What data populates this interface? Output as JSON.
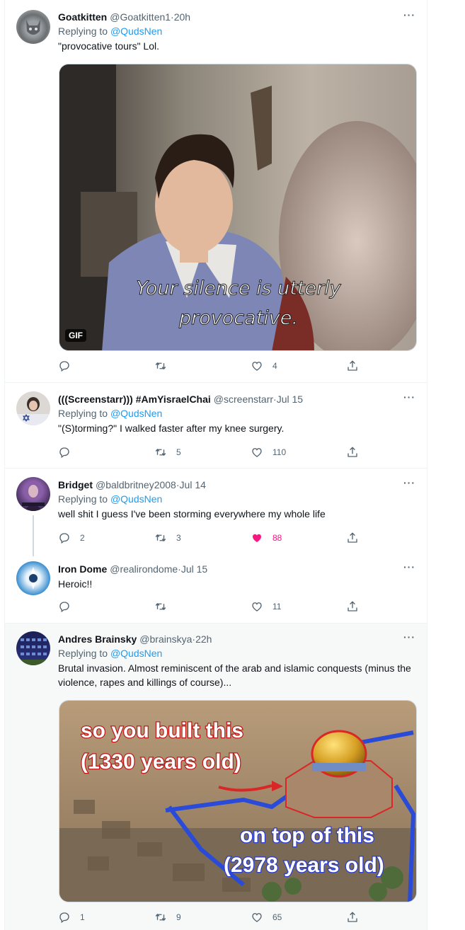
{
  "tweets": [
    {
      "name": "Goatkitten",
      "handle": "@Goatkitten1",
      "time": "20h",
      "replying_prefix": "Replying to ",
      "replying_to": "@QudsNen",
      "text": "\"provocative tours\" Lol.",
      "media": {
        "caption_line1": "Your silence is utterly",
        "caption_line2": "provocative.",
        "badge": "GIF"
      },
      "replies": "",
      "retweets": "",
      "likes": "4"
    },
    {
      "name": "(((Screenstarr))) #AmYisraelChai",
      "handle": "@screenstarr",
      "time": "Jul 15",
      "replying_prefix": "Replying to ",
      "replying_to": "@QudsNen",
      "text": "\"(S)torming?\" I walked faster after my knee surgery.",
      "replies": "",
      "retweets": "5",
      "likes": "110"
    },
    {
      "name": "Bridget",
      "handle": "@baldbritney2008",
      "time": "Jul 14",
      "replying_prefix": "Replying to ",
      "replying_to": "@QudsNen",
      "text": "well shit I guess I've been storming everywhere my whole life",
      "replies": "2",
      "retweets": "3",
      "likes": "88"
    },
    {
      "name": "Iron Dome",
      "handle": "@realirondome",
      "time": "Jul 15",
      "text": "Heroic!!",
      "replies": "",
      "retweets": "",
      "likes": "11"
    },
    {
      "name": "Andres Brainsky",
      "handle": "@brainskya",
      "time": "22h",
      "replying_prefix": "Replying to ",
      "replying_to": "@QudsNen",
      "text": "Brutal invasion. Almost reminiscent of the arab and islamic conquests (minus the violence, rapes and killings of course)...",
      "media": {
        "caption_top_line1": "so you built this",
        "caption_top_line2": "(1330 years old)",
        "caption_bottom_line1": "on top of this",
        "caption_bottom_line2": "(2978 years old)"
      },
      "replies": "1",
      "retweets": "9",
      "likes": "65"
    }
  ],
  "separator": " · ",
  "more_label": "···",
  "like_color": "#f91880",
  "link_color": "#1d9bf0",
  "icons": [
    "reply-icon",
    "retweet-icon",
    "like-icon",
    "share-icon",
    "more-icon"
  ]
}
